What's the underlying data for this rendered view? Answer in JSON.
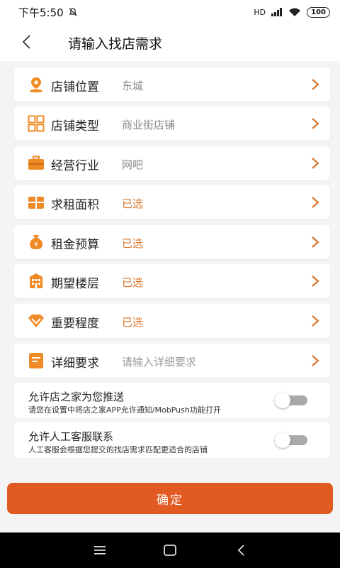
{
  "statusbar": {
    "time": "下午5:50",
    "network": "HD",
    "battery": "100"
  },
  "header": {
    "title": "请输入找店需求"
  },
  "rows": [
    {
      "label": "店铺位置",
      "value": "东城",
      "icon": "location-pin-icon"
    },
    {
      "label": "店铺类型",
      "value": "商业街店铺",
      "icon": "grid-icon"
    },
    {
      "label": "经营行业",
      "value": "网吧",
      "icon": "briefcase-icon"
    },
    {
      "label": "求租面积",
      "value": "已选",
      "icon": "package-icon"
    },
    {
      "label": "租金预算",
      "value": "已选",
      "icon": "money-bag-icon"
    },
    {
      "label": "期望楼层",
      "value": "已选",
      "icon": "building-icon"
    },
    {
      "label": "重要程度",
      "value": "已选",
      "icon": "diamond-icon"
    },
    {
      "label": "详细要求",
      "value": "请输入详细要求",
      "icon": "document-icon"
    }
  ],
  "toggles": [
    {
      "title": "允许店之家为您推送",
      "subtitle": "请您在设置中将店之家APP允许通知/MobPush功能打开",
      "on": false
    },
    {
      "title": "允许人工客服联系",
      "subtitle": "人工客服会根据您提交的找店需求匹配更适合的店铺",
      "on": false
    }
  ],
  "confirm_label": "确定",
  "colors": {
    "accent": "#e05a21",
    "selected_text": "#d9742b",
    "icon_orange": "#f08a24"
  }
}
